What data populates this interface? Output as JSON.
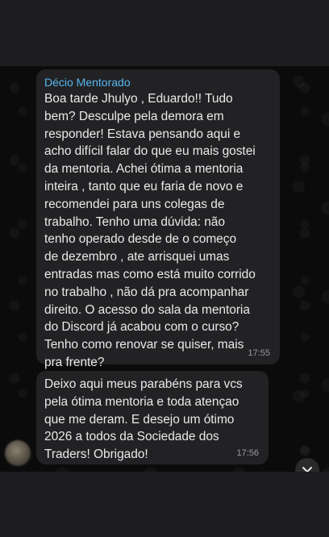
{
  "chat": {
    "messages": [
      {
        "sender": "Décio Mentorado",
        "text": "Boa tarde Jhulyo , Eduardo!!  Tudo\nbem?  Desculpe pela demora  em\nresponder! Estava pensando  aqui e\nacho difícil falar do que eu mais gostei\nda mentoria. Achei ótima a  mentoria\ninteira , tanto que eu faria  de  novo e\nrecomendei para uns colegas de\ntrabalho. Tenho  uma dúvida: não\ntenho operado desde de o  começo\nde  dezembro , ate arrisquei umas\nentradas mas como está muito corrido\nno trabalho ,  não dá pra acompanhar\ndireito. O  acesso do sala da mentoria\ndo Discord já acabou com o curso?\nTenho como renovar se quiser, mais\npra frente?",
        "time": "17:55"
      },
      {
        "text": "Deixo aqui meus parabéns para vcs\npela ótima mentoria e toda atençao\nque me deram. E desejo um ótimo\n2026 a todos da Sociedade dos\nTraders! Obrigado!",
        "time": "17:56"
      }
    ]
  },
  "icons": {
    "scroll_down": "chevron-down-icon",
    "avatar": "avatar"
  },
  "colors": {
    "background": "#0b0b0b",
    "bubble": "#222224",
    "sender_name": "#56b6f0",
    "text": "#e9e9ea",
    "timestamp": "#9a9a9c"
  }
}
